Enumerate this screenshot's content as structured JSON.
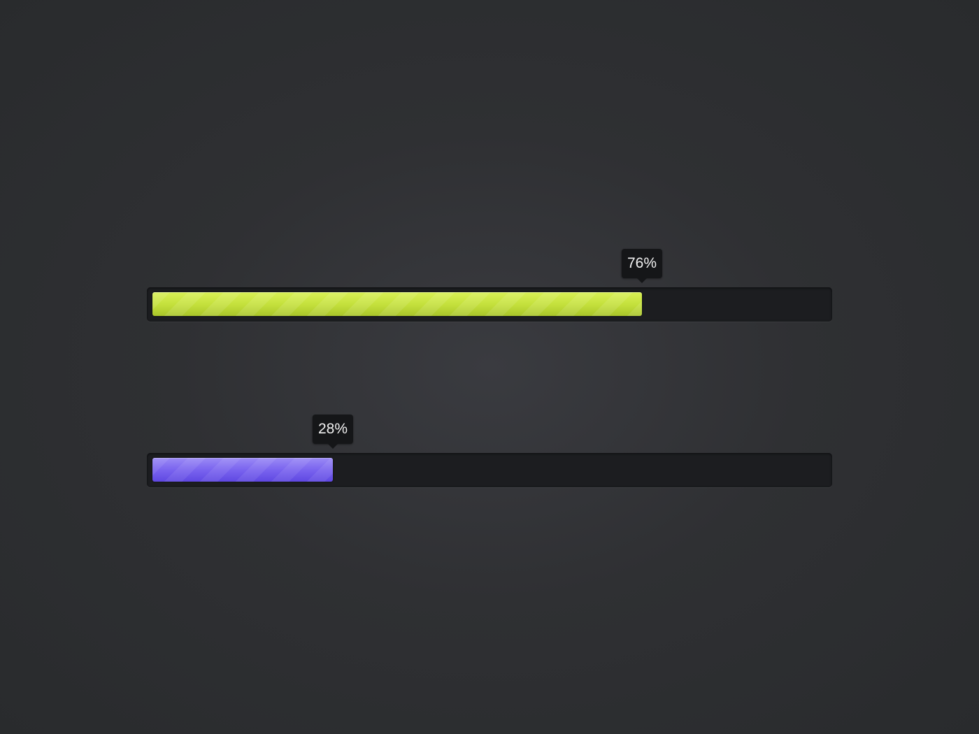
{
  "progress_bars": [
    {
      "label": "76%",
      "value": 0.76,
      "color": "#c5e13a"
    },
    {
      "label": "28%",
      "value": 0.28,
      "color": "#6b55e6"
    }
  ]
}
